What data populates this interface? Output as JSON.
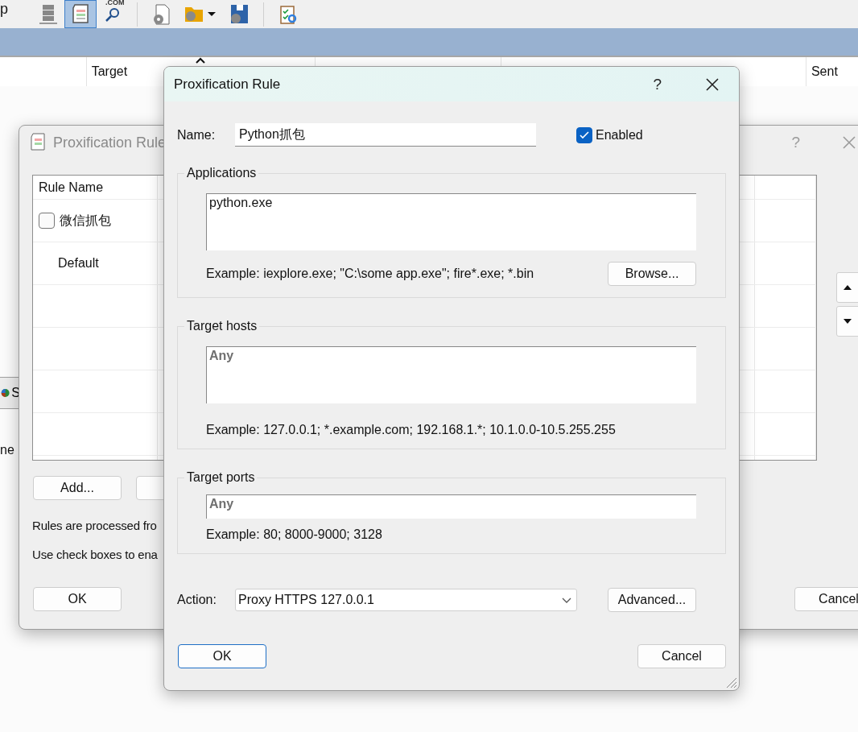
{
  "main_window": {
    "menu_fragment": "p",
    "toolbar": [
      {
        "buttons": [
          {
            "kind": "server",
            "selected": false
          },
          {
            "kind": "rules",
            "selected": true
          },
          {
            "kind": "dns",
            "caption": ".COM",
            "selected": false
          }
        ]
      },
      {
        "buttons": [
          {
            "kind": "settings_doc",
            "selected": false
          },
          {
            "kind": "open_profile",
            "selected": false
          },
          {
            "kind": "save_profile",
            "selected": false
          }
        ]
      },
      {
        "buttons": [
          {
            "kind": "checklist",
            "selected": false
          }
        ]
      }
    ],
    "columns": [
      {
        "label": "Target",
        "sorted": true
      },
      {
        "label": "Sent",
        "sorted": false
      }
    ],
    "side_button": "S",
    "side_text": "ne"
  },
  "rules_dialog": {
    "title": "Proxification Rule",
    "help": "?",
    "column": "Rule Name",
    "rows": [
      {
        "kind": "checkbox",
        "name": "微信抓包",
        "checked": false
      },
      {
        "kind": "plain",
        "name": "Default"
      }
    ],
    "add_button": "Add...",
    "notes": [
      "Rules are processed fro",
      "Use check boxes to ena"
    ],
    "ok": "OK",
    "cancel": "Cancel"
  },
  "rule_dialog": {
    "title": "Proxification Rule",
    "help": "?",
    "name_label": "Name:",
    "name": "Python抓包",
    "enabled": {
      "label": "Enabled",
      "checked": true
    },
    "groups": [
      {
        "kind": "multiline",
        "title": "Applications",
        "value": "python.exe",
        "example": "Example: iexplore.exe; \"C:\\some app.exe\"; fire*.exe; *.bin",
        "button": "Browse..."
      },
      {
        "kind": "multiline",
        "title": "Target hosts",
        "placeholder": "Any",
        "example": "Example: 127.0.0.1; *.example.com; 192.168.1.*; 10.1.0.0-10.5.255.255"
      },
      {
        "kind": "single",
        "title": "Target ports",
        "placeholder": "Any",
        "example": "Example: 80; 8000-9000; 3128"
      }
    ],
    "action_label": "Action:",
    "action": "Proxy HTTPS 127.0.0.1",
    "advanced": "Advanced...",
    "ok": "OK",
    "cancel": "Cancel"
  }
}
